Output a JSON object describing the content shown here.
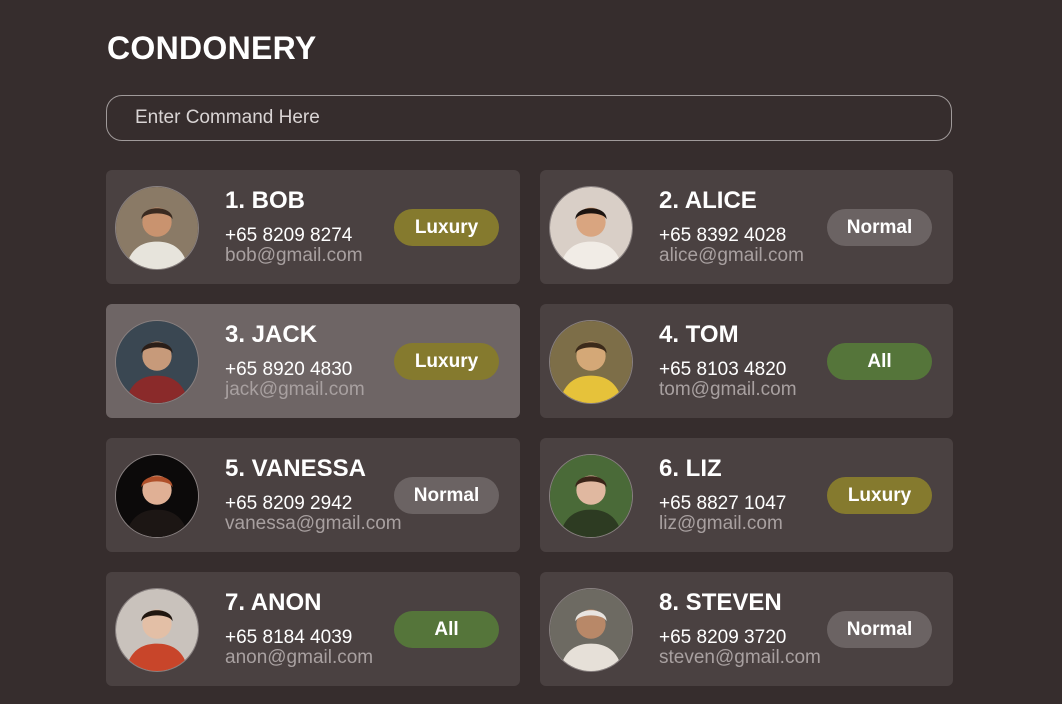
{
  "app": {
    "title": "CONDONERY"
  },
  "command": {
    "placeholder": "Enter Command Here",
    "value": ""
  },
  "contacts": [
    {
      "name": "1. BOB",
      "phone": "+65 8209 8274",
      "email": "bob@gmail.com",
      "tag": "Luxury",
      "tag_color": "#857a2e",
      "selected": false,
      "avatar_colors": [
        "#8a7a66",
        "#e7e4dc",
        "#c9936f",
        "#3a2a20"
      ]
    },
    {
      "name": "2. ALICE",
      "phone": "+65 8392 4028",
      "email": "alice@gmail.com",
      "tag": "Normal",
      "tag_color": "#6b6363",
      "selected": false,
      "avatar_colors": [
        "#d9cfc7",
        "#f1ece6",
        "#d9a580",
        "#1c1410"
      ]
    },
    {
      "name": "3. JACK",
      "phone": "+65 8920 4830",
      "email": "jack@gmail.com",
      "tag": "Luxury",
      "tag_color": "#857a2e",
      "selected": true,
      "avatar_colors": [
        "#3a4752",
        "#8a2a2a",
        "#c79a7a",
        "#2a1e18"
      ]
    },
    {
      "name": "4. TOM",
      "phone": "+65 8103 4820",
      "email": "tom@gmail.com",
      "tag": "All",
      "tag_color": "#55753a",
      "selected": false,
      "avatar_colors": [
        "#7d6e48",
        "#e6c23a",
        "#d4a877",
        "#3b2a1a"
      ]
    },
    {
      "name": "5. VANESSA",
      "phone": "+65 8209 2942",
      "email": "vanessa@gmail.com",
      "tag": "Normal",
      "tag_color": "#6b6363",
      "selected": false,
      "avatar_colors": [
        "#0c0a0a",
        "#1c1614",
        "#e0b095",
        "#b0502a"
      ]
    },
    {
      "name": "6. LIZ",
      "phone": "+65 8827 1047",
      "email": "liz@gmail.com",
      "tag": "Luxury",
      "tag_color": "#857a2e",
      "selected": false,
      "avatar_colors": [
        "#4a6a38",
        "#2d3b22",
        "#e0b8a0",
        "#3a2418"
      ]
    },
    {
      "name": "7. ANON",
      "phone": "+65 8184 4039",
      "email": "anon@gmail.com",
      "tag": "All",
      "tag_color": "#55753a",
      "selected": false,
      "avatar_colors": [
        "#c9c2bc",
        "#c8452a",
        "#e3bfa6",
        "#20160f"
      ]
    },
    {
      "name": "8. STEVEN",
      "phone": "+65 8209 3720",
      "email": "steven@gmail.com",
      "tag": "Normal",
      "tag_color": "#6b6363",
      "selected": false,
      "avatar_colors": [
        "#6d6a62",
        "#e6e0d8",
        "#b88868",
        "#e8e4e0"
      ]
    }
  ]
}
